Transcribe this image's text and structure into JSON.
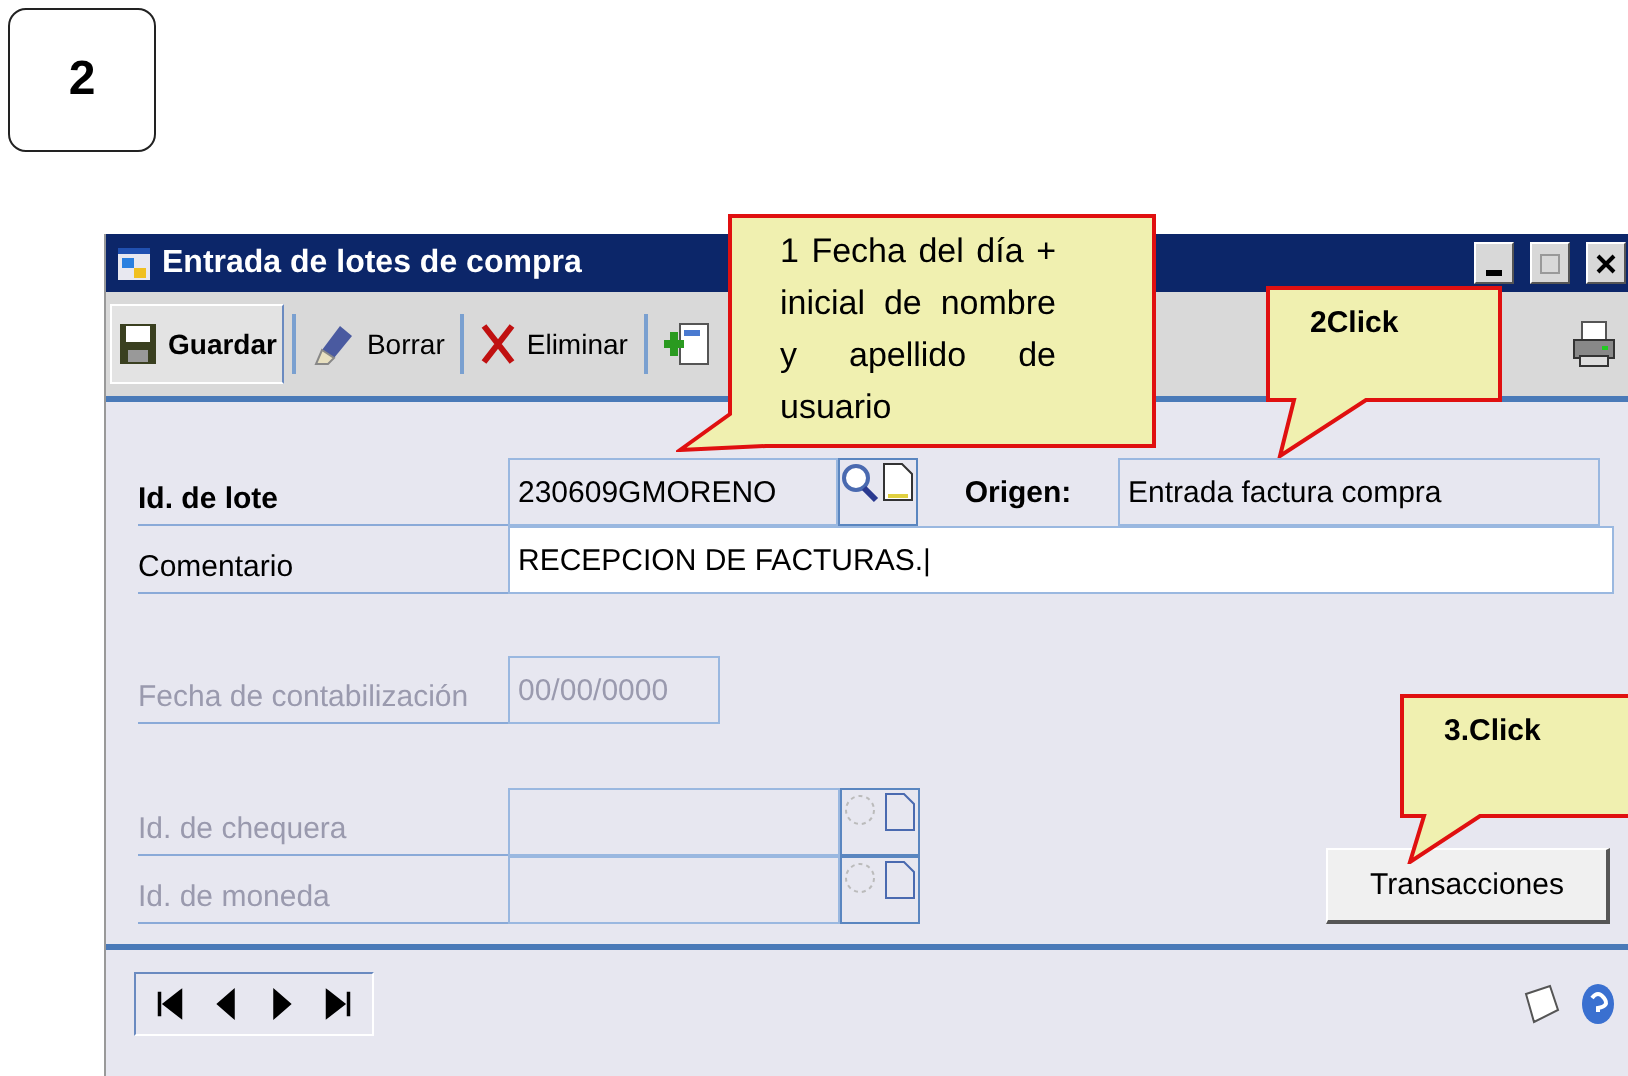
{
  "step_badge": "2",
  "window": {
    "title": "Entrada de lotes de compra"
  },
  "toolbar": [
    {
      "kind": "save",
      "label": "Guardar",
      "selected": true
    },
    {
      "kind": "clear",
      "label": "Borrar",
      "selected": false
    },
    {
      "kind": "delete",
      "label": "Eliminar",
      "selected": false
    },
    {
      "kind": "post",
      "selected": false
    }
  ],
  "batch_id": {
    "label": "Id. de lote",
    "value": "230609GMORENO"
  },
  "origin": {
    "label": "Origen:",
    "value": "Entrada factura compra"
  },
  "comment": {
    "label": "Comentario",
    "value": "RECEPCION DE FACTURAS.|"
  },
  "posting_date": {
    "label": "Fecha de contabilización",
    "value": "00/00/0000",
    "disabled": true
  },
  "checkbook_id": {
    "label": "Id. de chequera",
    "disabled": true
  },
  "currency_id": {
    "label": "Id. de moneda",
    "disabled": true
  },
  "transactions_button": {
    "label": "Transacciones"
  },
  "callouts": [
    {
      "text": "1 Fecha del día + inicial de nombre y apellido de usuario",
      "bold": false
    },
    {
      "text": "2Click",
      "bold": true
    },
    {
      "text": "3.Click",
      "bold": true
    }
  ]
}
